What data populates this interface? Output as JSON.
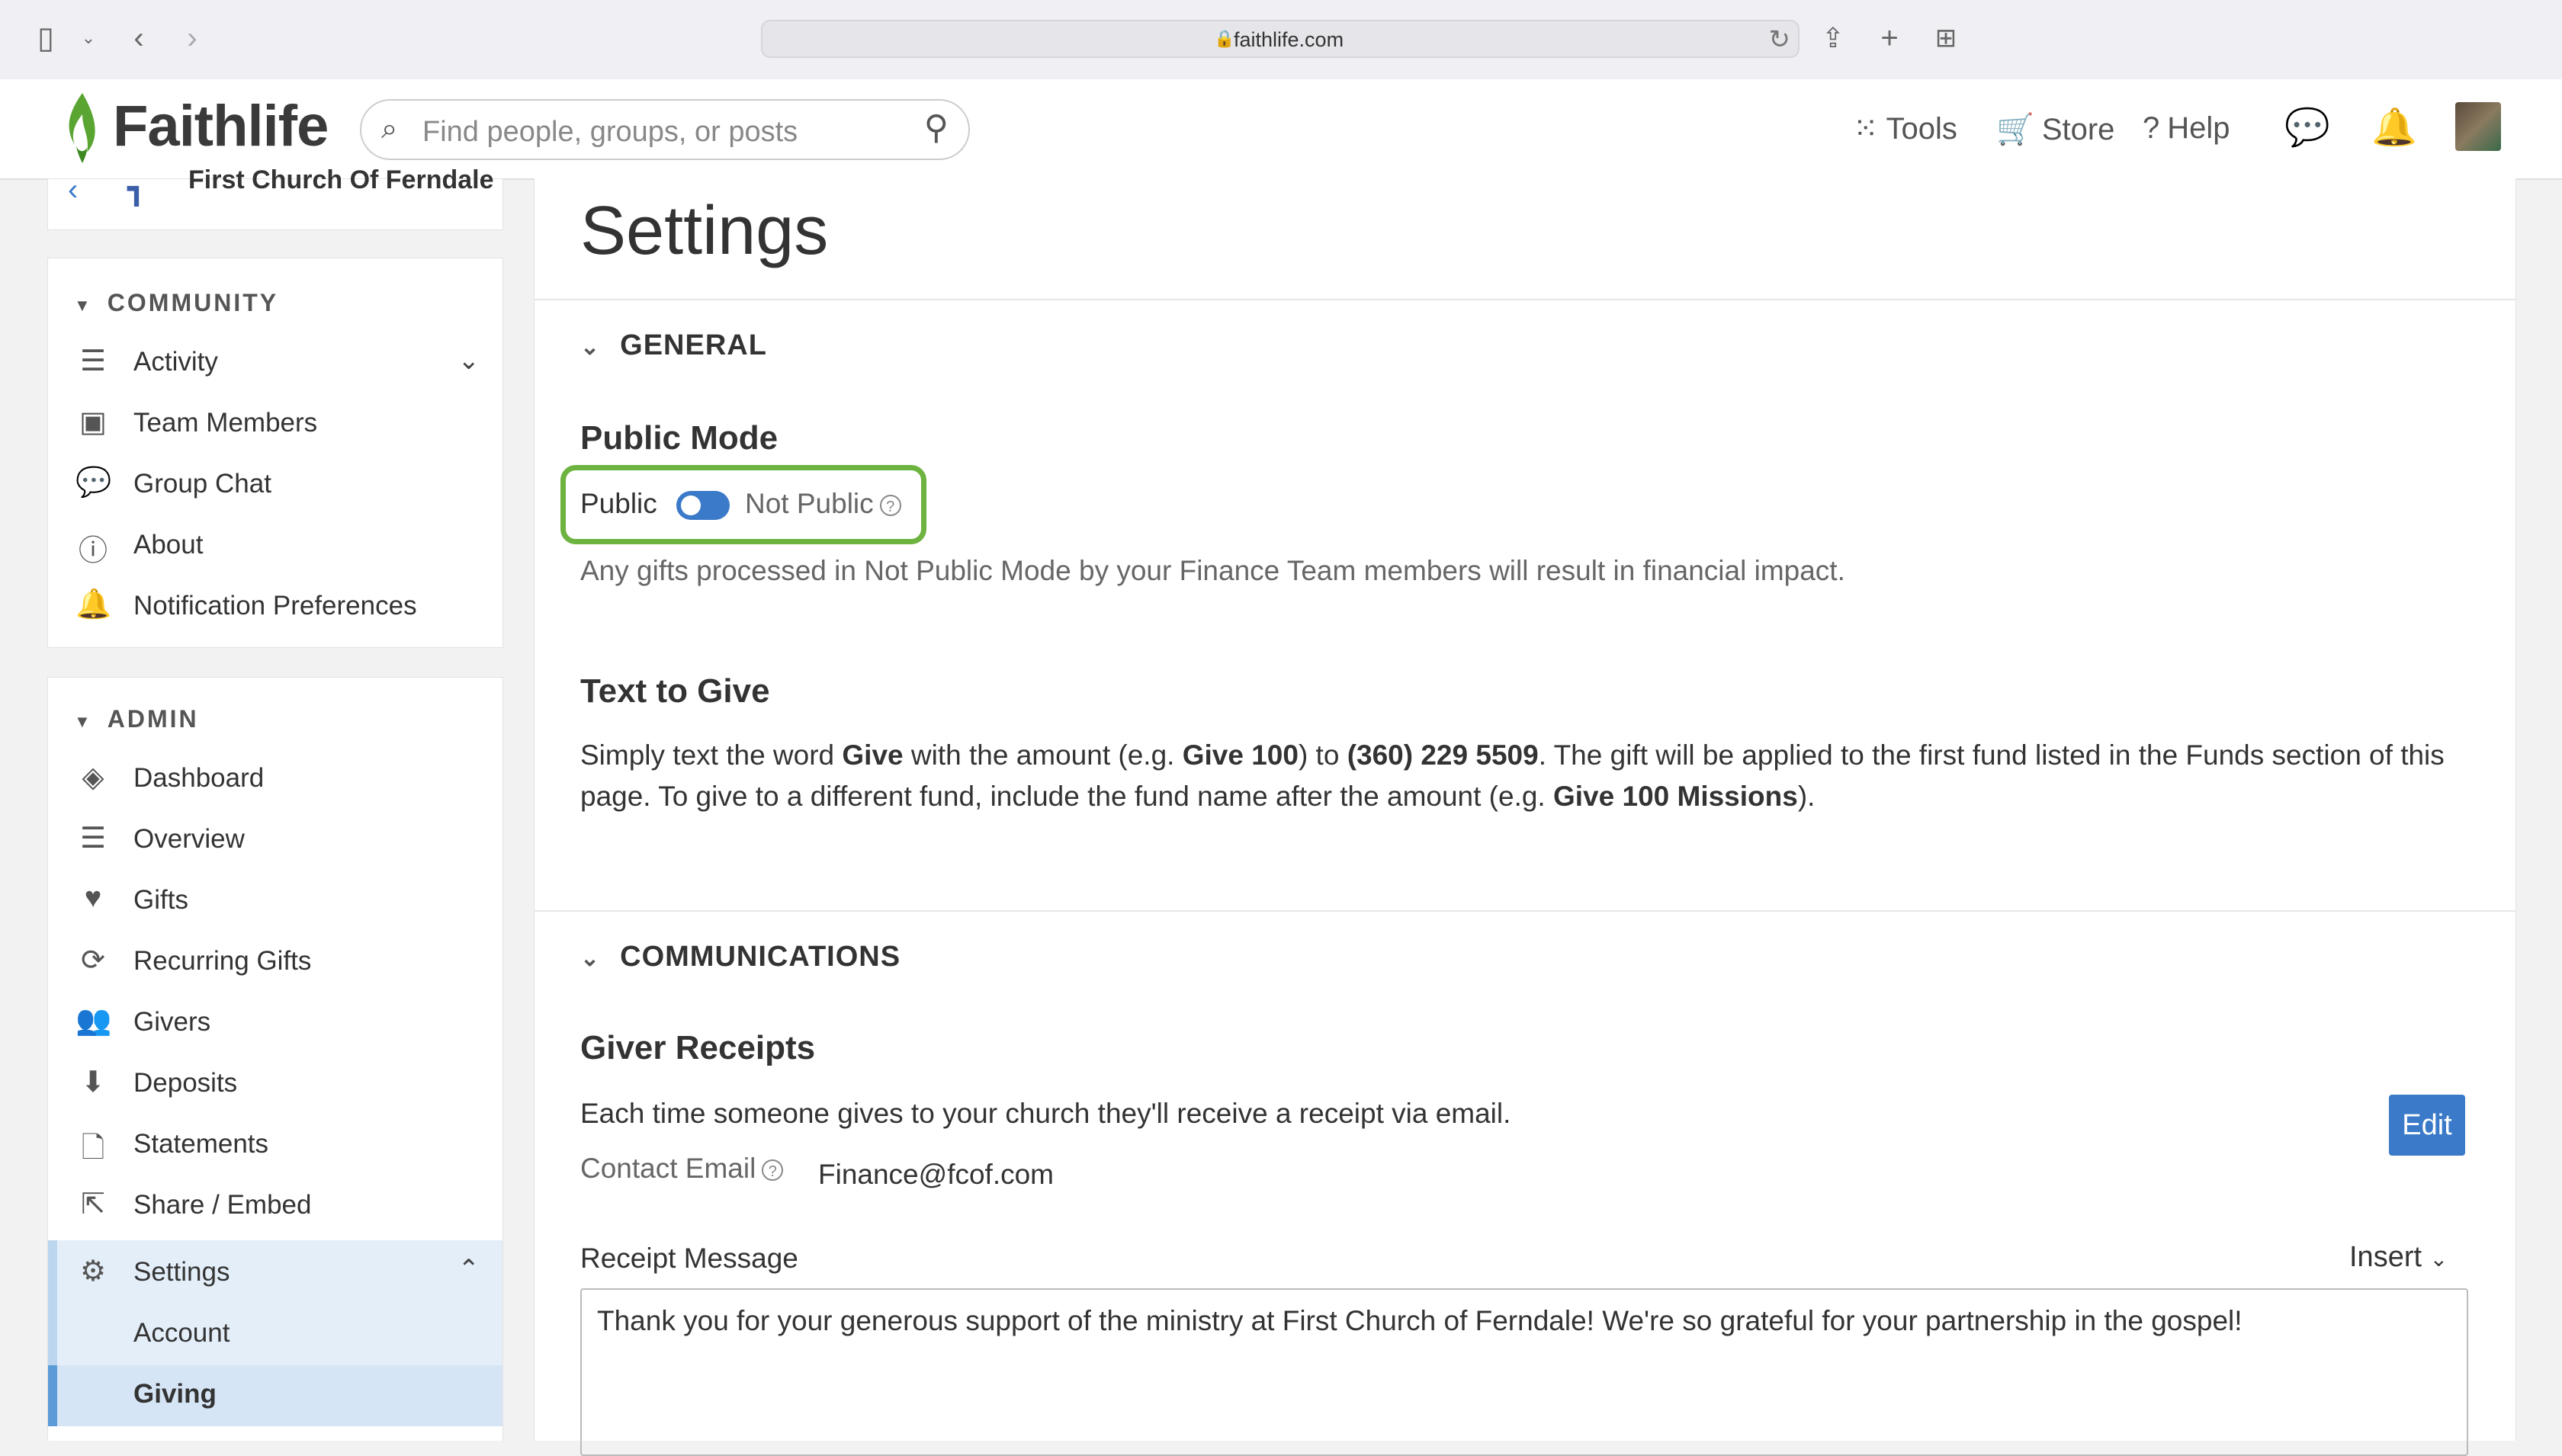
{
  "browser": {
    "url": "faithlife.com"
  },
  "header": {
    "logo_text": "Faithlife",
    "search_placeholder": "Find people, groups, or posts",
    "tools_label": "Tools",
    "store_label": "Store",
    "help_label": "Help"
  },
  "sidebar": {
    "group_name": "First Church Of Ferndale",
    "community_heading": "COMMUNITY",
    "community_items": [
      {
        "label": "Activity",
        "icon": "list-icon"
      },
      {
        "label": "Team Members",
        "icon": "badge-icon"
      },
      {
        "label": "Group Chat",
        "icon": "chat-icon"
      },
      {
        "label": "About",
        "icon": "info-icon"
      },
      {
        "label": "Notification Preferences",
        "icon": "bell-icon"
      }
    ],
    "admin_heading": "ADMIN",
    "admin_items": [
      {
        "label": "Dashboard",
        "icon": "dashboard-icon"
      },
      {
        "label": "Overview",
        "icon": "list-icon"
      },
      {
        "label": "Gifts",
        "icon": "heart-icon"
      },
      {
        "label": "Recurring Gifts",
        "icon": "recurring-icon"
      },
      {
        "label": "Givers",
        "icon": "people-icon"
      },
      {
        "label": "Deposits",
        "icon": "download-circle-icon"
      },
      {
        "label": "Statements",
        "icon": "document-icon"
      },
      {
        "label": "Share / Embed",
        "icon": "external-link-icon"
      },
      {
        "label": "Settings",
        "icon": "gear-icon"
      }
    ],
    "settings_subitems": [
      {
        "label": "Account"
      },
      {
        "label": "Giving"
      }
    ]
  },
  "main": {
    "title": "Settings",
    "general": {
      "heading": "GENERAL",
      "public_mode_title": "Public Mode",
      "public_label": "Public",
      "not_public_label": "Not Public",
      "public_note": "Any gifts processed in Not Public Mode by your Finance Team members will result in financial impact.",
      "text_to_give_title": "Text to Give",
      "ttg_1": "Simply text the word ",
      "ttg_b1": "Give",
      "ttg_2": " with the amount (e.g. ",
      "ttg_b2": "Give 100",
      "ttg_3": ") to ",
      "ttg_b3": "(360) 229 5509",
      "ttg_4": ". The gift will be applied to the first fund listed in the Funds section of this",
      "ttg_5": "page. To give to a different fund, include the fund name after the amount (e.g. ",
      "ttg_b4": "Give 100 Missions",
      "ttg_6": ")."
    },
    "communications": {
      "heading": "COMMUNICATIONS",
      "giver_receipts_title": "Giver Receipts",
      "receipts_desc": "Each time someone gives to your church they'll receive a receipt via email.",
      "edit_label": "Edit",
      "contact_email_label": "Contact Email",
      "contact_email_value": "Finance@fcof.com",
      "receipt_message_label": "Receipt Message",
      "insert_label": "Insert",
      "receipt_message": "Thank you for your generous support of the ministry at First Church of Ferndale! We're so grateful for your partnership in the gospel!"
    }
  },
  "colors": {
    "accent": "#3a7ac8",
    "highlight_outline": "#6cb33f",
    "logo_green": "#5aa532"
  }
}
